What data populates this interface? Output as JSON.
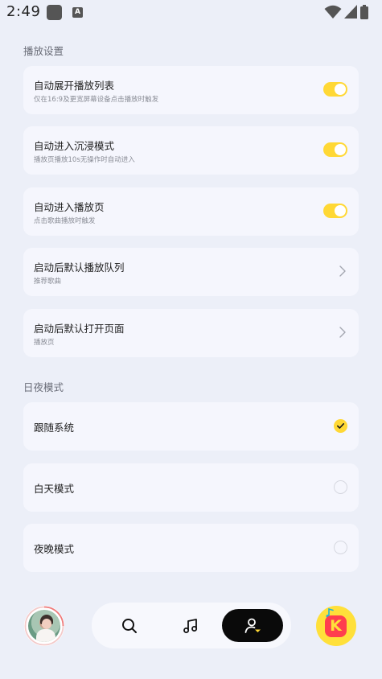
{
  "status_bar": {
    "time": "2:49",
    "a_icon": "A"
  },
  "sections": {
    "playback_title": "播放设置",
    "daynight_title": "日夜模式"
  },
  "playback_settings": [
    {
      "title": "自动展开播放列表",
      "subtitle": "仅在16:9及更宽屏幕设备点击播放时触发",
      "control": "toggle",
      "on": true
    },
    {
      "title": "自动进入沉浸模式",
      "subtitle": "播放页播放10s无操作时自动进入",
      "control": "toggle",
      "on": true
    },
    {
      "title": "自动进入播放页",
      "subtitle": "点击歌曲播放时触发",
      "control": "toggle",
      "on": true
    },
    {
      "title": "启动后默认播放队列",
      "subtitle": "推荐歌曲",
      "control": "chevron"
    },
    {
      "title": "启动后默认打开页面",
      "subtitle": "播放页",
      "control": "chevron"
    }
  ],
  "daynight_options": [
    {
      "title": "跟随系统",
      "selected": true
    },
    {
      "title": "白天模式",
      "selected": false
    },
    {
      "title": "夜晚模式",
      "selected": false
    }
  ],
  "colors": {
    "accent": "#ffd835",
    "background": "#eceff8",
    "card": "#f5f6fd"
  },
  "bottom_nav": {
    "items": [
      "search-icon",
      "music-note-icon",
      "profile-icon"
    ],
    "active": "profile-icon",
    "app_logo_letter": "K"
  }
}
